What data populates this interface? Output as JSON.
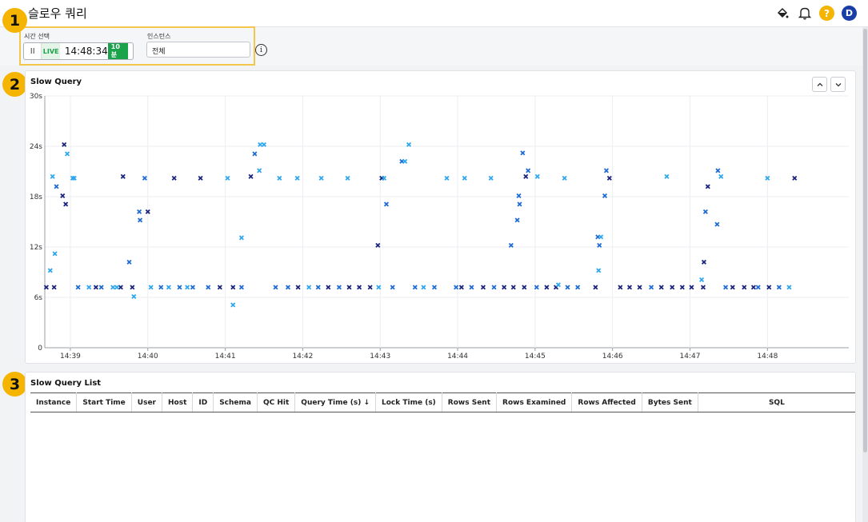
{
  "header": {
    "title": "슬로우 쿼리",
    "icons": [
      "paint-bucket-icon",
      "bell-icon",
      "help-icon",
      "user-avatar"
    ],
    "help_label": "?",
    "avatar_label": "D"
  },
  "filters": {
    "time_label": "시간 선택",
    "pause_glyph": "II",
    "live_label": "LIVE",
    "live_time": "14:48:34",
    "range_label": "10분",
    "instance_label": "인스턴스",
    "instance_value": "전체",
    "info_glyph": "i"
  },
  "steps": [
    "1",
    "2",
    "3"
  ],
  "chart": {
    "title": "Slow Query",
    "expand_up": "⌃",
    "expand_down": "⌄"
  },
  "chart_data": {
    "type": "scatter",
    "title": "Slow Query",
    "y_unit": "s",
    "ylim": [
      0,
      30
    ],
    "y_ticks": [
      "0",
      "6s",
      "12s",
      "18s",
      "24s",
      "30s"
    ],
    "y_tick_values": [
      0,
      6,
      12,
      18,
      24,
      30
    ],
    "x_ticks": [
      "14:39",
      "14:40",
      "14:41",
      "14:42",
      "14:43",
      "14:44",
      "14:45",
      "14:46",
      "14:47",
      "14:48"
    ],
    "x_tick_values": [
      1,
      2,
      3,
      4,
      5,
      6,
      7,
      8,
      9,
      10
    ],
    "xlim": [
      0.67,
      11.05
    ],
    "grid": true,
    "colors": {
      "dark": "#1a237e",
      "mid": "#1e6bd6",
      "light": "#2ea7ee"
    },
    "series": [
      {
        "color": "dark",
        "points": [
          [
            0.69,
            7.2
          ],
          [
            0.79,
            7.2
          ],
          [
            0.92,
            24.2
          ],
          [
            0.9,
            18.1
          ],
          [
            0.94,
            17.1
          ],
          [
            1.33,
            7.2
          ],
          [
            1.65,
            7.2
          ],
          [
            1.68,
            20.4
          ],
          [
            1.8,
            7.2
          ],
          [
            2,
            16.2
          ],
          [
            2.34,
            20.2
          ],
          [
            2.68,
            20.2
          ],
          [
            2.93,
            7.2
          ],
          [
            3.1,
            7.2
          ],
          [
            3.33,
            20.4
          ],
          [
            3.94,
            7.2
          ],
          [
            4.33,
            7.2
          ],
          [
            4.6,
            7.2
          ],
          [
            4.73,
            7.2
          ],
          [
            4.87,
            7.2
          ],
          [
            4.97,
            12.2
          ],
          [
            5.02,
            20.2
          ],
          [
            6.05,
            7.2
          ],
          [
            6.33,
            7.2
          ],
          [
            6.6,
            7.2
          ],
          [
            6.72,
            7.2
          ],
          [
            6.86,
            7.2
          ],
          [
            6.88,
            20.4
          ],
          [
            7.15,
            7.2
          ],
          [
            7.27,
            7.2
          ],
          [
            7.78,
            7.2
          ],
          [
            7.96,
            20.2
          ],
          [
            8.1,
            7.2
          ],
          [
            8.22,
            7.2
          ],
          [
            8.35,
            7.2
          ],
          [
            8.63,
            7.2
          ],
          [
            8.77,
            7.2
          ],
          [
            8.9,
            7.2
          ],
          [
            9.02,
            7.2
          ],
          [
            9.17,
            7.2
          ],
          [
            9.18,
            10.2
          ],
          [
            9.23,
            19.2
          ],
          [
            9.55,
            7.2
          ],
          [
            9.7,
            7.2
          ],
          [
            9.82,
            7.2
          ],
          [
            10.02,
            7.2
          ],
          [
            10.35,
            20.2
          ]
        ]
      },
      {
        "color": "mid",
        "points": [
          [
            0.82,
            19.2
          ],
          [
            1.1,
            7.2
          ],
          [
            1.4,
            7.2
          ],
          [
            1.76,
            10.2
          ],
          [
            1.89,
            16.2
          ],
          [
            1.9,
            15.2
          ],
          [
            1.96,
            20.2
          ],
          [
            2.17,
            7.2
          ],
          [
            2.41,
            7.2
          ],
          [
            2.58,
            7.2
          ],
          [
            2.78,
            7.2
          ],
          [
            3.21,
            7.2
          ],
          [
            3.38,
            23.1
          ],
          [
            3.65,
            7.2
          ],
          [
            3.81,
            7.2
          ],
          [
            4.2,
            7.2
          ],
          [
            4.47,
            7.2
          ],
          [
            5.08,
            17.1
          ],
          [
            5.16,
            7.2
          ],
          [
            5.28,
            22.2
          ],
          [
            5.45,
            7.2
          ],
          [
            5.7,
            7.2
          ],
          [
            5.98,
            7.2
          ],
          [
            6.18,
            7.2
          ],
          [
            6.47,
            7.2
          ],
          [
            6.69,
            12.2
          ],
          [
            6.77,
            15.2
          ],
          [
            6.79,
            18.1
          ],
          [
            6.8,
            17.1
          ],
          [
            6.84,
            23.2
          ],
          [
            6.91,
            21.1
          ],
          [
            7.02,
            7.2
          ],
          [
            7.42,
            7.2
          ],
          [
            7.55,
            7.2
          ],
          [
            7.81,
            13.2
          ],
          [
            7.83,
            12.2
          ],
          [
            7.9,
            18.1
          ],
          [
            7.92,
            21.1
          ],
          [
            8.5,
            7.2
          ],
          [
            9.2,
            16.2
          ],
          [
            9.35,
            14.7
          ],
          [
            9.36,
            21.1
          ],
          [
            9.46,
            7.2
          ],
          [
            9.88,
            7.2
          ],
          [
            10.15,
            7.2
          ]
        ]
      },
      {
        "color": "light",
        "points": [
          [
            0.74,
            9.2
          ],
          [
            0.77,
            20.4
          ],
          [
            0.8,
            11.2
          ],
          [
            0.96,
            23.1
          ],
          [
            1.03,
            20.2
          ],
          [
            1.05,
            20.2
          ],
          [
            1.24,
            7.2
          ],
          [
            1.6,
            7.2
          ],
          [
            1.55,
            7.2
          ],
          [
            1.82,
            6.1
          ],
          [
            2.04,
            7.2
          ],
          [
            2.27,
            7.2
          ],
          [
            2.51,
            7.2
          ],
          [
            3.03,
            20.2
          ],
          [
            3.1,
            5.1
          ],
          [
            3.21,
            13.1
          ],
          [
            3.44,
            21.1
          ],
          [
            3.45,
            24.2
          ],
          [
            3.5,
            24.2
          ],
          [
            3.7,
            20.2
          ],
          [
            3.93,
            20.2
          ],
          [
            4.08,
            7.2
          ],
          [
            4.24,
            20.2
          ],
          [
            4.58,
            20.2
          ],
          [
            4.98,
            7.2
          ],
          [
            5.05,
            20.2
          ],
          [
            5.32,
            22.2
          ],
          [
            5.37,
            24.2
          ],
          [
            5.56,
            7.2
          ],
          [
            5.86,
            20.2
          ],
          [
            6.09,
            20.2
          ],
          [
            6.43,
            20.2
          ],
          [
            7.03,
            20.4
          ],
          [
            7.3,
            7.5
          ],
          [
            7.38,
            20.2
          ],
          [
            7.82,
            9.2
          ],
          [
            7.85,
            13.2
          ],
          [
            8.7,
            20.4
          ],
          [
            9.15,
            8.1
          ],
          [
            9.4,
            20.4
          ],
          [
            10.0,
            20.2
          ],
          [
            10.28,
            7.2
          ]
        ]
      }
    ]
  },
  "list": {
    "title": "Slow Query List",
    "columns": [
      "Instance",
      "Start Time",
      "User",
      "Host",
      "ID",
      "Schema",
      "QC Hit",
      "Query Time (s) ↓",
      "Lock Time (s)",
      "Rows Sent",
      "Rows Examined",
      "Rows Affected",
      "Bytes Sent",
      "SQL"
    ]
  }
}
